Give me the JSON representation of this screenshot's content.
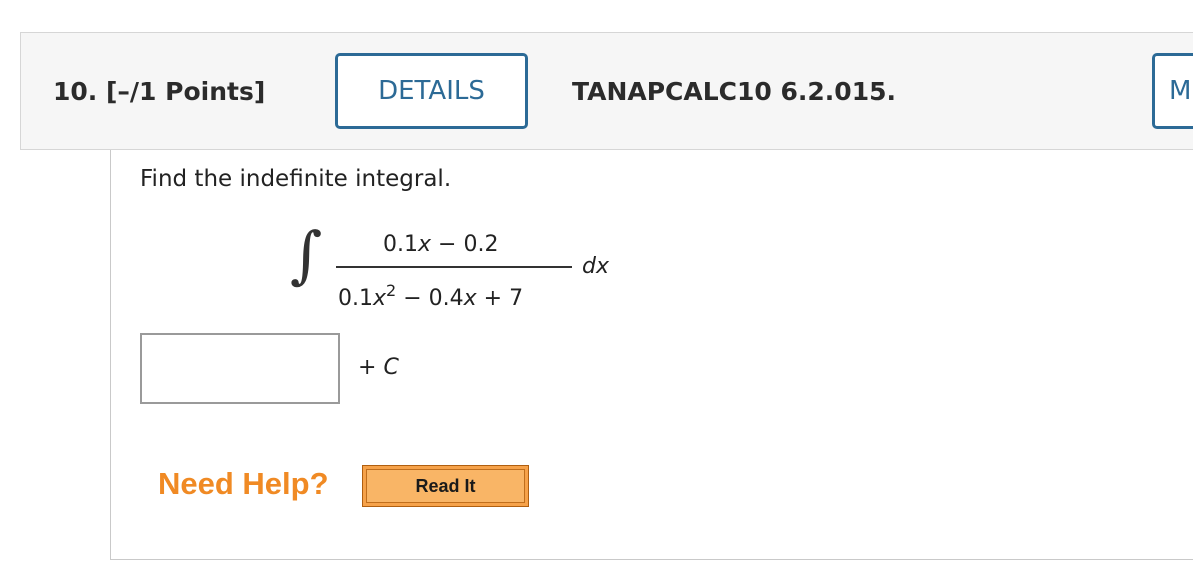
{
  "header": {
    "question_label": "10. [–/1 Points]",
    "details_label": "DETAILS",
    "question_code": "TANAPCALC10 6.2.015.",
    "next_button_label": "M"
  },
  "problem": {
    "prompt": "Find the indefinite integral.",
    "integral_symbol": "∫",
    "numerator": {
      "coef1": "0.1",
      "var1": "x",
      "rest": " − 0.2"
    },
    "denominator": {
      "coef1": "0.1",
      "var1": "x",
      "exp": "2",
      "minus": " − 0.4",
      "var2": "x",
      "rest": " + 7"
    },
    "differential": "dx"
  },
  "answer": {
    "value": "",
    "placeholder": "",
    "suffix_plus": "+ ",
    "suffix_c": "C"
  },
  "help": {
    "need_help_label": "Need Help?",
    "read_it_label": "Read It"
  },
  "colors": {
    "accent": "#2c6a96",
    "help_orange": "#f08a24",
    "read_it_fill": "#f9b566"
  }
}
